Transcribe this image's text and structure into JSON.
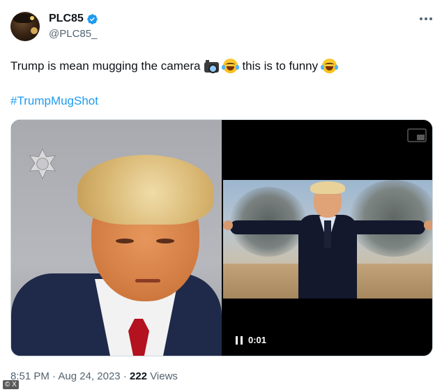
{
  "author": {
    "display_name": "PLC85",
    "handle": "@PLC85_",
    "verified": true
  },
  "tweet": {
    "text_part1": "Trump is mean mugging the camera",
    "text_part2": "this is to funny",
    "emojis": [
      "camera-with-flash-emoji",
      "face-with-tears-of-joy-emoji",
      "face-with-tears-of-joy-emoji"
    ],
    "hashtag": "#TrumpMugShot"
  },
  "media": {
    "video_time": "0:01",
    "video_state": "paused-icon"
  },
  "meta": {
    "time": "8:51 PM",
    "separator1": "·",
    "date": "Aug 24, 2023",
    "separator2": "·",
    "views_count": "222",
    "views_label": "Views"
  },
  "watermark": "© X",
  "colors": {
    "link": "#1d9bf0",
    "secondary_text": "#536471",
    "primary_text": "#0f1419",
    "verified": "#1d9bf0"
  }
}
